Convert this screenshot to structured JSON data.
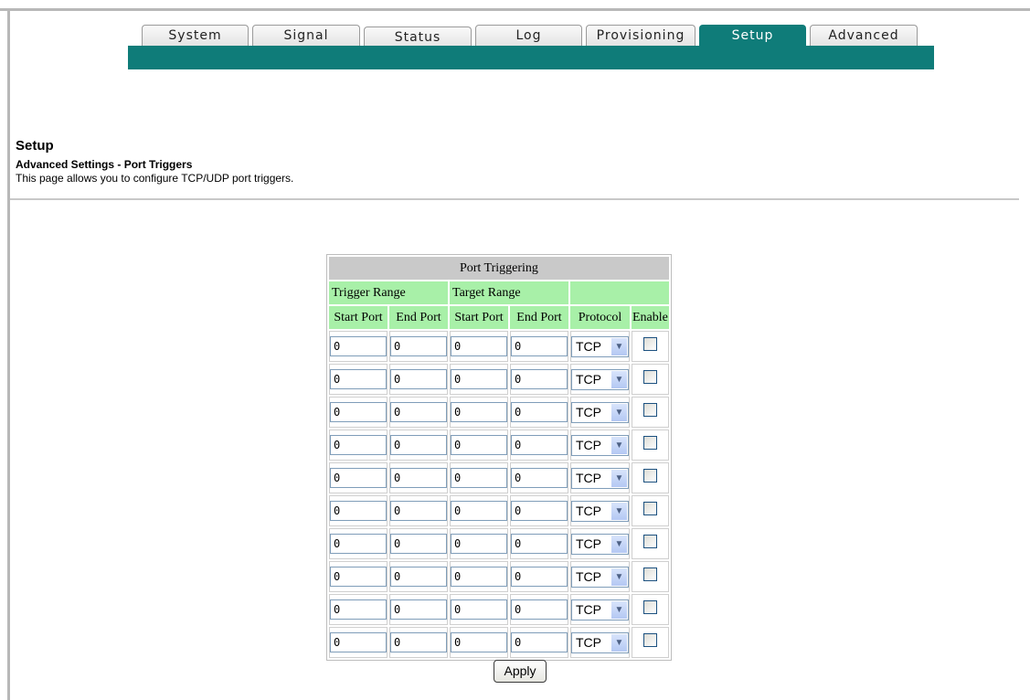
{
  "nav": {
    "tabs": [
      {
        "label": "System"
      },
      {
        "label": "Signal"
      },
      {
        "label": "Status"
      },
      {
        "label": "Log"
      },
      {
        "label": "Provisioning"
      },
      {
        "label": "Setup",
        "active": true
      },
      {
        "label": "Advanced"
      }
    ]
  },
  "colors": {
    "accent": "#0f7c79",
    "header_green": "#a8f0a8",
    "caption_gray": "#c9c9c9"
  },
  "page": {
    "title": "Setup",
    "subtitle": "Advanced Settings - Port Triggers",
    "description": "This page allows you to configure TCP/UDP port triggers."
  },
  "table": {
    "caption": "Port Triggering",
    "group_headers": {
      "trigger": "Trigger Range",
      "target": "Target Range"
    },
    "columns": [
      "Start Port",
      "End Port",
      "Start Port",
      "End Port",
      "Protocol",
      "Enable"
    ],
    "rows": [
      {
        "trigger_start": "0",
        "trigger_end": "0",
        "target_start": "0",
        "target_end": "0",
        "protocol": "TCP",
        "enabled": false
      },
      {
        "trigger_start": "0",
        "trigger_end": "0",
        "target_start": "0",
        "target_end": "0",
        "protocol": "TCP",
        "enabled": false
      },
      {
        "trigger_start": "0",
        "trigger_end": "0",
        "target_start": "0",
        "target_end": "0",
        "protocol": "TCP",
        "enabled": false
      },
      {
        "trigger_start": "0",
        "trigger_end": "0",
        "target_start": "0",
        "target_end": "0",
        "protocol": "TCP",
        "enabled": false
      },
      {
        "trigger_start": "0",
        "trigger_end": "0",
        "target_start": "0",
        "target_end": "0",
        "protocol": "TCP",
        "enabled": false
      },
      {
        "trigger_start": "0",
        "trigger_end": "0",
        "target_start": "0",
        "target_end": "0",
        "protocol": "TCP",
        "enabled": false
      },
      {
        "trigger_start": "0",
        "trigger_end": "0",
        "target_start": "0",
        "target_end": "0",
        "protocol": "TCP",
        "enabled": false
      },
      {
        "trigger_start": "0",
        "trigger_end": "0",
        "target_start": "0",
        "target_end": "0",
        "protocol": "TCP",
        "enabled": false
      },
      {
        "trigger_start": "0",
        "trigger_end": "0",
        "target_start": "0",
        "target_end": "0",
        "protocol": "TCP",
        "enabled": false
      },
      {
        "trigger_start": "0",
        "trigger_end": "0",
        "target_start": "0",
        "target_end": "0",
        "protocol": "TCP",
        "enabled": false
      }
    ]
  },
  "apply_label": "Apply"
}
